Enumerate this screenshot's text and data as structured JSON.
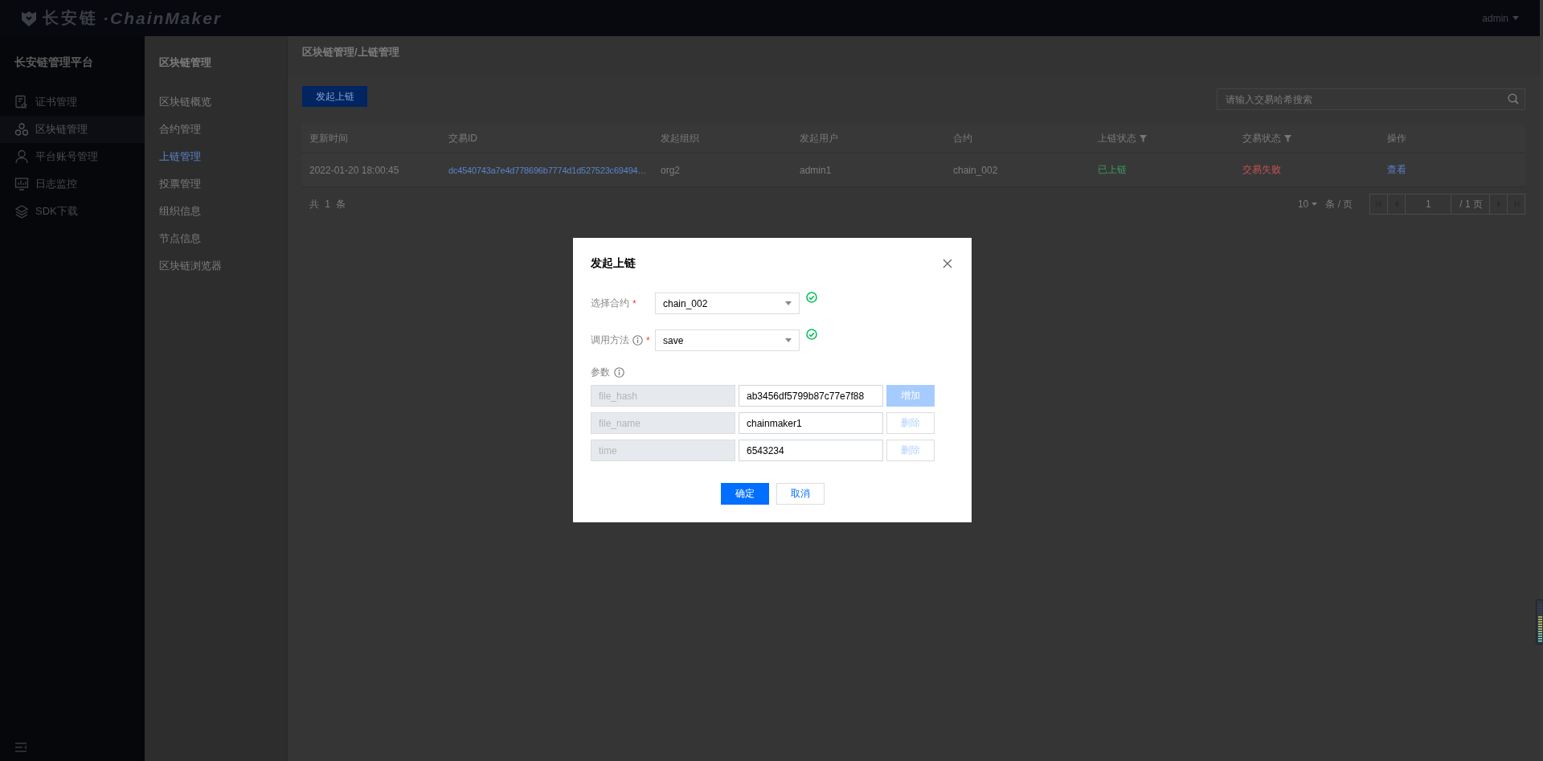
{
  "header": {
    "logo_name": "长安链",
    "logo_tagline": "·ChainMaker",
    "user": "admin"
  },
  "sidebar": {
    "title": "长安链管理平台",
    "items": [
      {
        "label": "证书管理",
        "selected": false
      },
      {
        "label": "区块链管理",
        "selected": true
      },
      {
        "label": "平台账号管理",
        "selected": false
      },
      {
        "label": "日志监控",
        "selected": false
      },
      {
        "label": "SDK下载",
        "selected": false
      }
    ]
  },
  "subnav": {
    "title": "区块链管理",
    "items": [
      {
        "label": "区块链概览",
        "selected": false
      },
      {
        "label": "合约管理",
        "selected": false
      },
      {
        "label": "上链管理",
        "selected": true
      },
      {
        "label": "投票管理",
        "selected": false
      },
      {
        "label": "组织信息",
        "selected": false
      },
      {
        "label": "节点信息",
        "selected": false
      },
      {
        "label": "区块链浏览器",
        "selected": false
      }
    ]
  },
  "main": {
    "breadcrumb": "区块链管理/上链管理",
    "new_button": "发起上链",
    "search": {
      "placeholder": "请输入交易哈希搜索"
    },
    "table": {
      "columns": [
        {
          "label": "更新时间",
          "filter": false
        },
        {
          "label": "交易ID",
          "filter": false
        },
        {
          "label": "发起组织",
          "filter": false
        },
        {
          "label": "发起用户",
          "filter": false
        },
        {
          "label": "合约",
          "filter": false
        },
        {
          "label": "上链状态",
          "filter": true
        },
        {
          "label": "交易状态",
          "filter": true
        },
        {
          "label": "操作",
          "filter": false
        }
      ],
      "rows": [
        {
          "cells": [
            {
              "text": "2022-01-20 18:00:45",
              "kind": "text"
            },
            {
              "text": "dc4540743a7e4d778696b7774d1d527523c69494…",
              "kind": "link"
            },
            {
              "text": "org2",
              "kind": "text"
            },
            {
              "text": "admin1",
              "kind": "text"
            },
            {
              "text": "chain_002",
              "kind": "text"
            },
            {
              "text": "已上链",
              "kind": "success"
            },
            {
              "text": "交易失败",
              "kind": "error"
            },
            {
              "text": "查看",
              "kind": "action"
            }
          ]
        }
      ]
    },
    "pagination": {
      "total": "共 1 条",
      "page_size": "10",
      "page_size_unit": "条 / 页",
      "page": "1",
      "page_count": "/ 1 页"
    }
  },
  "dialog": {
    "title": "发起上链",
    "fields": [
      {
        "label": "选择合约",
        "info": false,
        "required_mark": "*",
        "value": "chain_002",
        "valid": true
      },
      {
        "label": "调用方法",
        "info": true,
        "required_mark": "*",
        "value": "save",
        "valid": true
      }
    ],
    "params_label": "参数",
    "params_info": true,
    "params": [
      {
        "name": "file_hash",
        "value": "ab3456df5799b87c77e7f88",
        "action": "增加",
        "kind": "add"
      },
      {
        "name": "file_name",
        "value": "chainmaker1",
        "action": "删除",
        "kind": "remove"
      },
      {
        "name": "time",
        "value": "6543234",
        "action": "删除",
        "kind": "remove"
      }
    ],
    "buttons": [
      {
        "label": "确定",
        "kind": "primary"
      },
      {
        "label": "取消",
        "kind": "default"
      }
    ]
  }
}
